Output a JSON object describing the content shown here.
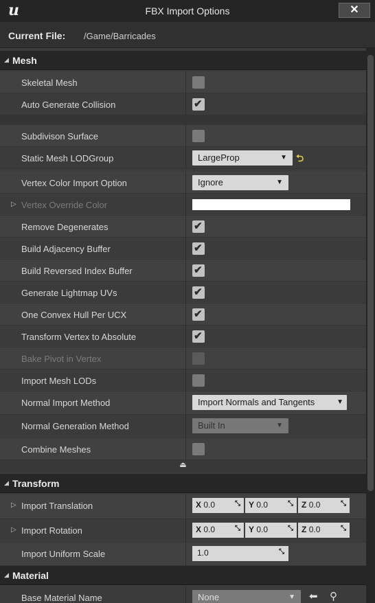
{
  "window": {
    "logo": "u",
    "title": "FBX Import Options",
    "close": "✕"
  },
  "current_file": {
    "label": "Current File:",
    "value": "/Game/Barricades"
  },
  "sections": {
    "mesh": "Mesh",
    "transform": "Transform",
    "material": "Material"
  },
  "mesh": {
    "skeletal_mesh": {
      "label": "Skeletal Mesh",
      "checked": false
    },
    "auto_generate_collision": {
      "label": "Auto Generate Collision",
      "checked": true
    },
    "subdivision_surface": {
      "label": "Subdivison Surface",
      "checked": false
    },
    "static_mesh_lodgroup": {
      "label": "Static Mesh LODGroup",
      "value": "LargeProp"
    },
    "vertex_color_import_option": {
      "label": "Vertex Color Import Option",
      "value": "Ignore"
    },
    "vertex_override_color": {
      "label": "Vertex Override Color",
      "color": "#ffffff"
    },
    "remove_degenerates": {
      "label": "Remove Degenerates",
      "checked": true
    },
    "build_adjacency_buffer": {
      "label": "Build Adjacency Buffer",
      "checked": true
    },
    "build_reversed_index_buffer": {
      "label": "Build Reversed Index Buffer",
      "checked": true
    },
    "generate_lightmap_uvs": {
      "label": "Generate Lightmap UVs",
      "checked": true
    },
    "one_convex_hull_per_ucx": {
      "label": "One Convex Hull Per UCX",
      "checked": true
    },
    "transform_vertex_to_absolute": {
      "label": "Transform Vertex to Absolute",
      "checked": true
    },
    "bake_pivot_in_vertex": {
      "label": "Bake Pivot in Vertex",
      "checked": false
    },
    "import_mesh_lods": {
      "label": "Import Mesh LODs",
      "checked": false
    },
    "normal_import_method": {
      "label": "Normal Import Method",
      "value": "Import Normals and Tangents"
    },
    "normal_generation_method": {
      "label": "Normal Generation Method",
      "value": "Built In"
    },
    "combine_meshes": {
      "label": "Combine Meshes",
      "checked": false
    }
  },
  "transform": {
    "import_translation": {
      "label": "Import Translation",
      "x": "0.0",
      "y": "0.0",
      "z": "0.0"
    },
    "import_rotation": {
      "label": "Import Rotation",
      "x": "0.0",
      "y": "0.0",
      "z": "0.0"
    },
    "import_uniform_scale": {
      "label": "Import Uniform Scale",
      "value": "1.0"
    }
  },
  "axis_labels": {
    "x": "X",
    "y": "Y",
    "z": "Z"
  },
  "material": {
    "base_material_name": {
      "label": "Base Material Name",
      "value": "None"
    }
  },
  "colors": {
    "accent_reset": "#e6c94a",
    "checked": "#c2c2c2",
    "unchecked": "#7a7a7a"
  }
}
